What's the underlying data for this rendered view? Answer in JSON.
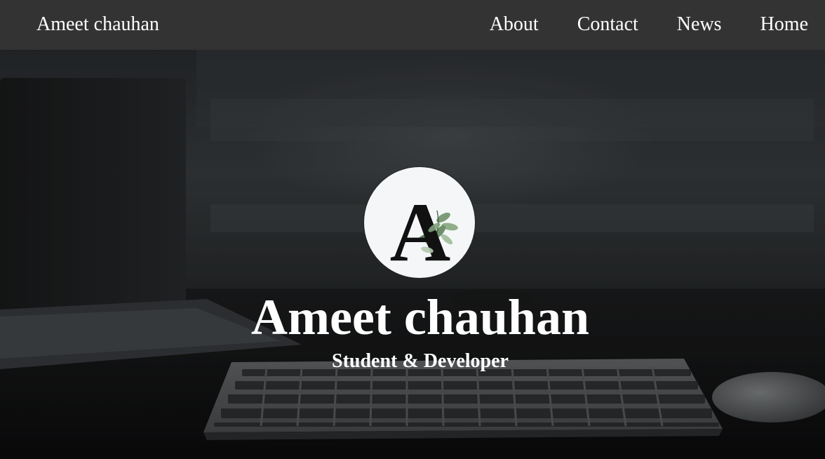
{
  "navbar": {
    "brand": "Ameet chauhan",
    "links": [
      {
        "label": "About"
      },
      {
        "label": "Contact"
      },
      {
        "label": "News"
      },
      {
        "label": "Home"
      }
    ]
  },
  "hero": {
    "logo_icon": "letter-a-leaf-logo",
    "title": "Ameet chauhan",
    "subtitle": "Student & Developer"
  },
  "colors": {
    "navbar_bg": "#333333",
    "text": "#ffffff",
    "logo_bg": "#f4f6f7"
  }
}
